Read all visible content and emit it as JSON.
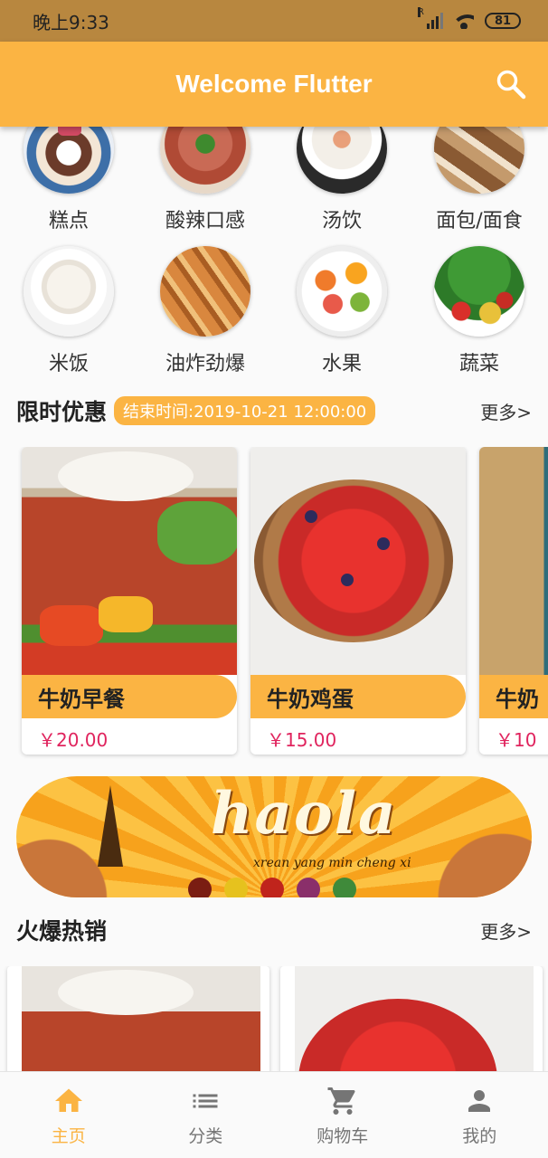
{
  "status_bar": {
    "time": "晚上9:33",
    "battery": "81",
    "signal_label": "R"
  },
  "app_bar": {
    "title": "Welcome Flutter"
  },
  "icons": {
    "search": "search-icon",
    "home": "home-icon",
    "category": "list-icon",
    "cart": "cart-icon",
    "profile": "person-icon"
  },
  "categories": [
    {
      "label": "糕点"
    },
    {
      "label": "酸辣口感"
    },
    {
      "label": "汤饮"
    },
    {
      "label": "面包/面食"
    },
    {
      "label": "米饭"
    },
    {
      "label": "油炸劲爆"
    },
    {
      "label": "水果"
    },
    {
      "label": "蔬菜"
    }
  ],
  "limited_offer": {
    "title": "限时优惠",
    "deadline": "结束时间:2019-10-21 12:00:00",
    "more": "更多>",
    "items": [
      {
        "name": "牛奶早餐",
        "price": "￥20.00"
      },
      {
        "name": "牛奶鸡蛋",
        "price": "￥15.00"
      },
      {
        "name": "牛奶",
        "price": "￥10"
      }
    ]
  },
  "banner": {
    "title": "haola",
    "subtitle": "xrean",
    "tagline": "yang min cheng xi"
  },
  "hot_sales": {
    "title": "火爆热销",
    "more": "更多>"
  },
  "bottom_nav": {
    "items": [
      {
        "label": "主页"
      },
      {
        "label": "分类"
      },
      {
        "label": "购物车"
      },
      {
        "label": "我的"
      }
    ]
  },
  "colors": {
    "accent": "#fbb443",
    "status_bar": "#b8873f",
    "price": "#e0245e"
  }
}
